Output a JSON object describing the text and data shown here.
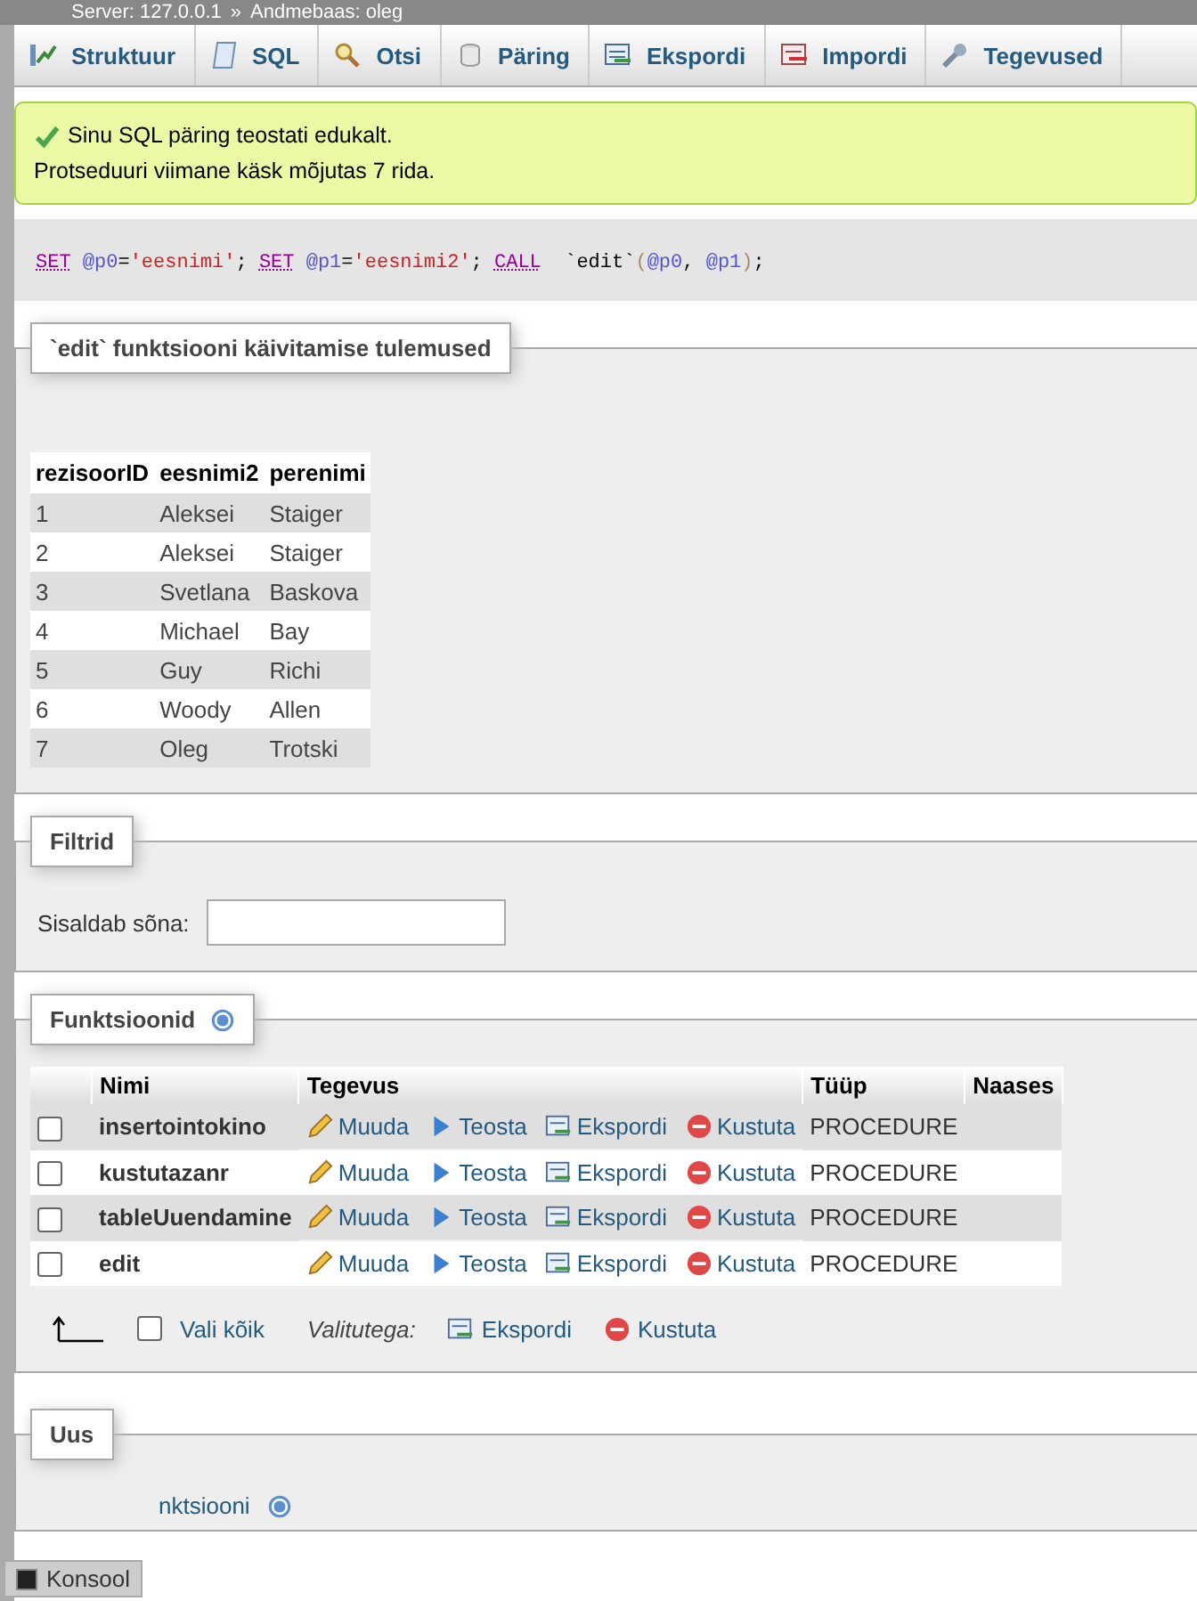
{
  "breadcrumb": {
    "server": "Server: 127.0.0.1",
    "separator": "»",
    "database": "Andmebaas: oleg"
  },
  "tabs": [
    {
      "label": "Struktuur"
    },
    {
      "label": "SQL"
    },
    {
      "label": "Otsi"
    },
    {
      "label": "Päring"
    },
    {
      "label": "Ekspordi"
    },
    {
      "label": "Impordi"
    },
    {
      "label": "Tegevused"
    }
  ],
  "message": {
    "line1": "Sinu SQL päring teostati edukalt.",
    "line2": "Protseduuri viimane käsk mõjutas 7 rida."
  },
  "sql": [
    {
      "kind": "keyword",
      "text": "SET"
    },
    {
      "kind": "var",
      "text": "@p0"
    },
    {
      "kind": "plain",
      "text": "="
    },
    {
      "kind": "string",
      "text": "'eesnimi'"
    },
    {
      "kind": "plain",
      "text": "; "
    },
    {
      "kind": "keyword",
      "text": "SET"
    },
    {
      "kind": "var",
      "text": "@p1"
    },
    {
      "kind": "plain",
      "text": "="
    },
    {
      "kind": "string",
      "text": "'eesnimi2'"
    },
    {
      "kind": "plain",
      "text": "; "
    },
    {
      "kind": "keyword",
      "text": "CALL"
    },
    {
      "kind": "plain",
      "text": " `edit`"
    },
    {
      "kind": "paren",
      "text": "("
    },
    {
      "kind": "var",
      "text": "@p0"
    },
    {
      "kind": "plain",
      "text": ", "
    },
    {
      "kind": "var",
      "text": "@p1"
    },
    {
      "kind": "paren",
      "text": ")"
    },
    {
      "kind": "plain",
      "text": ";"
    }
  ],
  "results": {
    "legend": "`edit` funktsiooni käivitamise tulemused",
    "columns": [
      "rezisoorID",
      "eesnimi2",
      "perenimi"
    ],
    "rows": [
      [
        "1",
        "Aleksei",
        "Staiger"
      ],
      [
        "2",
        "Aleksei",
        "Staiger"
      ],
      [
        "3",
        "Svetlana",
        "Baskova"
      ],
      [
        "4",
        "Michael",
        "Bay"
      ],
      [
        "5",
        "Guy",
        "Richi"
      ],
      [
        "6",
        "Woody",
        "Allen"
      ],
      [
        "7",
        "Oleg",
        "Trotski"
      ]
    ]
  },
  "filters": {
    "legend": "Filtrid",
    "label": "Sisaldab sõna:"
  },
  "functions": {
    "legend": "Funktsioonid",
    "columns": [
      "Nimi",
      "Tegevus",
      "Tüüp",
      "Naases"
    ],
    "rows": [
      {
        "name": "insertointokino",
        "checked": false,
        "actions": [
          "Muuda",
          "Teosta",
          "Ekspordi",
          "Kustuta"
        ],
        "type": "PROCEDURE"
      },
      {
        "name": "kustutazanr",
        "checked": false,
        "actions": [
          "Muuda",
          "Teosta",
          "Ekspordi",
          "Kustuta"
        ],
        "type": "PROCEDURE"
      },
      {
        "name": "tableUuendamine",
        "checked": false,
        "actions": [
          "Muuda",
          "Teosta",
          "Ekspordi",
          "Kustuta"
        ],
        "type": "PROCEDURE"
      },
      {
        "name": "edit",
        "checked": false,
        "actions": [
          "Muuda",
          "Teosta",
          "Ekspordi",
          "Kustuta"
        ],
        "type": "PROCEDURE"
      }
    ],
    "select_all": {
      "label": "Vali kõik",
      "checked": false
    },
    "with_selected": "Valitutega:",
    "bulk_actions": [
      "Ekspordi",
      "Kustuta"
    ]
  },
  "new": {
    "legend": "Uus",
    "link": "nktsiooni"
  },
  "console": {
    "label": "Konsool"
  }
}
